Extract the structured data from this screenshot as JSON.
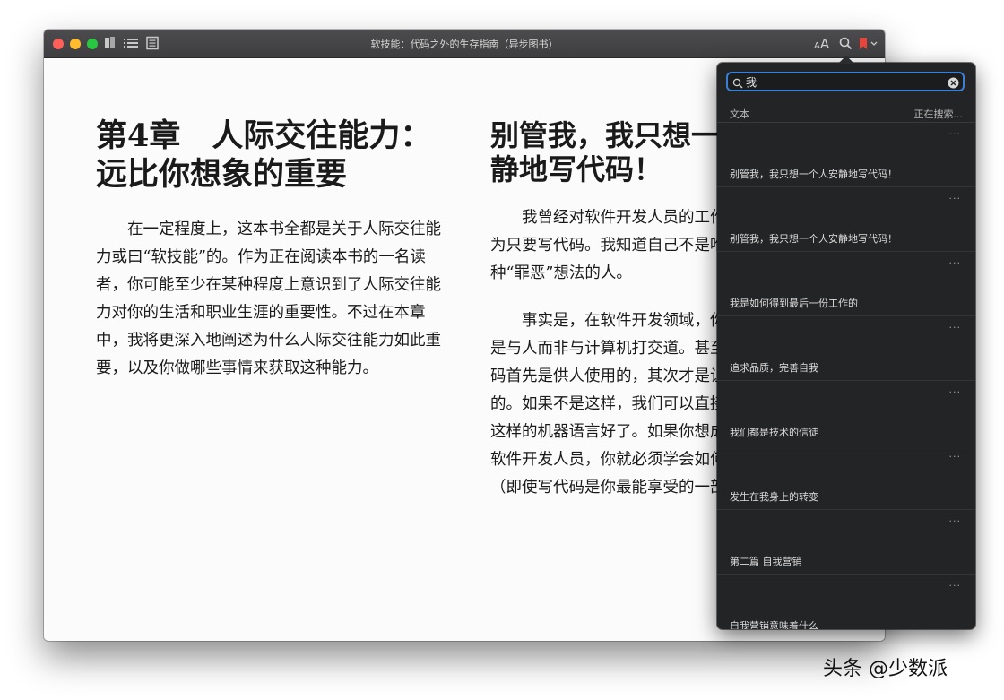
{
  "window": {
    "title": "软技能：代码之外的生存指南（异步图书）",
    "traffic_colors": [
      "#fe5f57",
      "#febc2e",
      "#28c840"
    ],
    "font_size_label_small": "A",
    "font_size_label_large": "A"
  },
  "left_page": {
    "chapter_title": "第4章　人际交往能力：远比你想象的重要",
    "paragraph": "在一定程度上，这本书全都是关于人际交往能力或曰“软技能”的。作为正在阅读本书的一名读者，你可能至少在某种程度上意识到了人际交往能力对你的生活和职业生涯的重要性。不过在本章中，我将更深入地阐述为什么人际交往能力如此重要，以及你做哪些事情来获取这种能力。",
    "page_marker": "··"
  },
  "right_page": {
    "section_title": "别管我，我只想一个人安静地写代码！",
    "paragraph1": "我曾经对软件开发人员的工作有所误解，以为只要写代码。我知道自己不是唯一一个有这种“罪恶”想法的人。",
    "paragraph2": "事实是，在软件开发领域，你在大多数时候是与人而非与计算机打交道。甚至，你编写的代码首先是供人使用的，其次才是让机器可以理解的。如果不是这样，我们可以直接把代码写成0/1这样的机器语言好了。如果你想成为一名出色的软件开发人员，你就必须学会如何与他人相处（即使写代码是你最能享受的一部分）。",
    "page_marker": "··"
  },
  "search": {
    "query": "我",
    "col_text": "文本",
    "col_status": "正在搜索...",
    "results": [
      {
        "text": "别管我，我只想一个人安静地写代码！",
        "more": "···"
      },
      {
        "text": "别管我，我只想一个人安静地写代码！",
        "more": "···"
      },
      {
        "text": "我是如何得到最后一份工作的",
        "more": "···"
      },
      {
        "text": "追求品质，完善自我",
        "more": "···"
      },
      {
        "text": "我们都是技术的信徒",
        "more": "···"
      },
      {
        "text": "发生在我身上的转变",
        "more": "···"
      },
      {
        "text": "第二篇 自我营销",
        "more": "···"
      },
      {
        "text": "自我营销意味着什么",
        "more": "···"
      }
    ]
  },
  "watermark": "头条 @少数派"
}
